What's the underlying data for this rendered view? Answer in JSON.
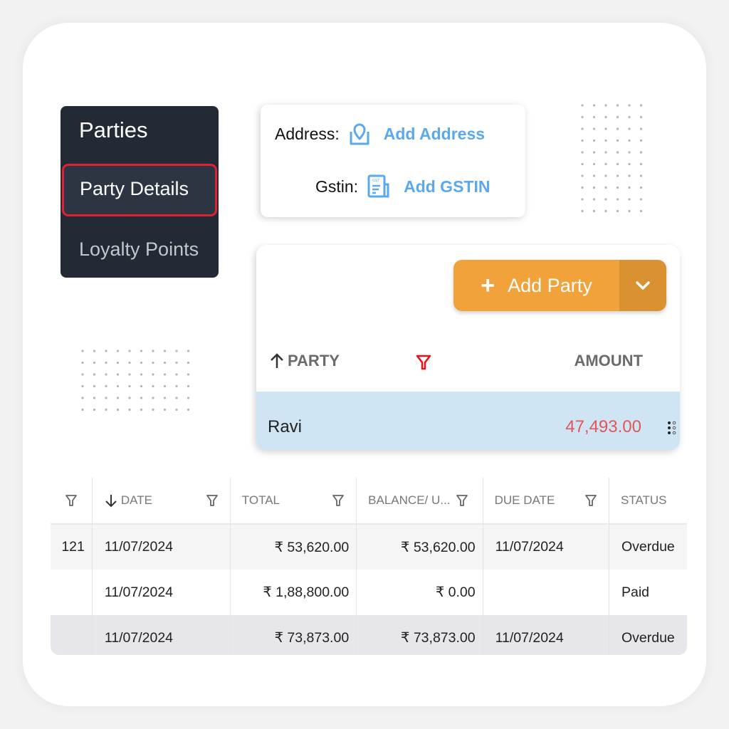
{
  "menu": {
    "title": "Parties",
    "items": [
      {
        "label": "Party Details",
        "active": true
      },
      {
        "label": "Loyalty Points",
        "active": false
      }
    ],
    "active_outline_color": "#e02131"
  },
  "details": {
    "address_label": "Address:",
    "address_link": "Add Address",
    "address_icon": "map-pin-icon",
    "gstin_label": "Gstin:",
    "gstin_link": "Add GSTIN",
    "gstin_icon": "gst-document-icon",
    "gst_badge": "GST",
    "link_color": "#5aa8ee"
  },
  "party_panel": {
    "add_button": {
      "icon": "plus",
      "label": "Add Party",
      "dropdown_icon": "chevron-down-icon",
      "color": "#f2a23a"
    },
    "columns": {
      "party": "PARTY",
      "amount": "AMOUNT",
      "sort_icon": "arrow-up-icon",
      "filter_icon": "filter-icon"
    },
    "rows": [
      {
        "name": "Ravi",
        "amount": "47,493.00",
        "amount_color": "#e15759",
        "selected": true
      }
    ]
  },
  "transactions": {
    "columns": [
      {
        "label": "",
        "filter": true
      },
      {
        "label": "DATE",
        "sort": "desc",
        "filter": true
      },
      {
        "label": "TOTAL",
        "filter": true
      },
      {
        "label": "BALANCE/ U...",
        "filter": true
      },
      {
        "label": "DUE DATE",
        "filter": true
      },
      {
        "label": "STATUS",
        "filter": false
      }
    ],
    "rows": [
      {
        "no": "121",
        "date": "11/07/2024",
        "total": "₹ 53,620.00",
        "balance": "₹ 53,620.00",
        "due_date": "11/07/2024",
        "status": "Overdue"
      },
      {
        "no": "",
        "date": "11/07/2024",
        "total": "₹ 1,88,800.00",
        "balance": "₹ 0.00",
        "due_date": "",
        "status": "Paid"
      },
      {
        "no": "",
        "date": "11/07/2024",
        "total": "₹ 73,873.00",
        "balance": "₹ 73,873.00",
        "due_date": "11/07/2024",
        "status": "Overdue"
      }
    ]
  }
}
